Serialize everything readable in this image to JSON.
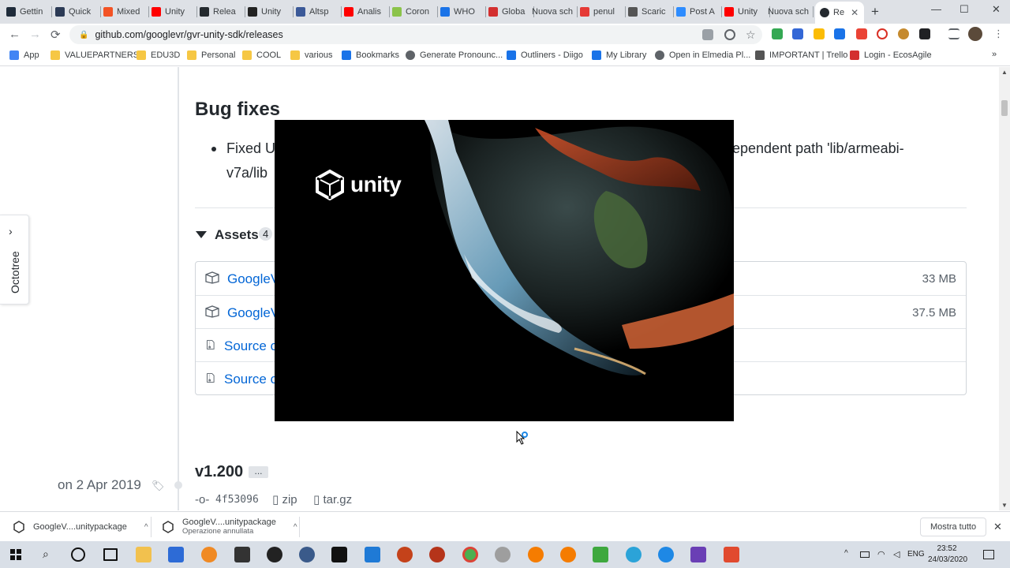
{
  "browser": {
    "tabs": [
      {
        "label": "Gettin",
        "color": "#1f2b3a"
      },
      {
        "label": "Quick",
        "color": "#2b3a55"
      },
      {
        "label": "Mixed",
        "color": "#f35325"
      },
      {
        "label": "Unity",
        "color": "#ff0000"
      },
      {
        "label": "Relea",
        "color": "#24292e"
      },
      {
        "label": "Unity",
        "color": "#222222"
      },
      {
        "label": "Altsp",
        "color": "#3b5998"
      },
      {
        "label": "Analis",
        "color": "#ff0000"
      },
      {
        "label": "Coron",
        "color": "#8bc34a"
      },
      {
        "label": "WHO",
        "color": "#1a73e8"
      },
      {
        "label": "Globa",
        "color": "#d32f2f"
      },
      {
        "label": "Nuova sch",
        "color": ""
      },
      {
        "label": "penul",
        "color": "#e53935"
      },
      {
        "label": "Scaric",
        "color": "#555555"
      },
      {
        "label": "Post A",
        "color": "#2d8cff"
      },
      {
        "label": "Unity",
        "color": "#ff0000"
      },
      {
        "label": "Nuova sch",
        "color": ""
      }
    ],
    "active_tab": {
      "label": "Re",
      "close": "✕"
    },
    "new_tab": "+",
    "window": {
      "minimize": "—",
      "maximize": "☐",
      "close": "✕"
    },
    "url": "github.com/googlevr/gvr-unity-sdk/releases",
    "nav": {
      "back": "←",
      "forward": "→",
      "reload": "⟳"
    },
    "bookmarks": [
      {
        "label": "App",
        "kind": "apps"
      },
      {
        "label": "VALUEPARTNERS",
        "kind": "folder"
      },
      {
        "label": "EDU3D",
        "kind": "folder"
      },
      {
        "label": "Personal",
        "kind": "folder"
      },
      {
        "label": "COOL",
        "kind": "folder"
      },
      {
        "label": "various",
        "kind": "folder"
      },
      {
        "label": "Bookmarks",
        "kind": "star"
      },
      {
        "label": "Generate Pronounc...",
        "kind": "globe"
      },
      {
        "label": "Outliners - Diigo",
        "kind": "diigo"
      },
      {
        "label": "My Library",
        "kind": "diigo"
      },
      {
        "label": "Open in Elmedia Pl...",
        "kind": "globe"
      },
      {
        "label": "IMPORTANT | Trello",
        "kind": "trello"
      },
      {
        "label": "Login - EcosAgile",
        "kind": "ecos"
      }
    ],
    "bookmarks_more": "»"
  },
  "page": {
    "section_heading": "Bug fixes",
    "bug_item": {
      "part1": "Fixed U",
      "part2": "ependent path 'lib/armeabi-",
      "part3": "v7a/lib"
    },
    "assets": {
      "label": "Assets",
      "count": "4",
      "rows": [
        {
          "name": "GoogleV",
          "size": "33 MB",
          "icon": "package-icon"
        },
        {
          "name": "GoogleV",
          "size": "37.5 MB",
          "icon": "package-icon"
        },
        {
          "name": "Source c",
          "size": "",
          "icon": "zip-icon"
        },
        {
          "name": "Source c",
          "size": "",
          "icon": "zip-icon"
        }
      ]
    },
    "octotree": {
      "label": "Octotree",
      "chevron": "›"
    },
    "release": {
      "date": "on 2 Apr 2019",
      "version": "v1.200",
      "more": "...",
      "commit": "4f53096",
      "zip": "zip",
      "targz": "tar.gz"
    }
  },
  "splash": {
    "logo_text": "unity"
  },
  "downloads": {
    "items": [
      {
        "name": "GoogleV....unitypackage",
        "status": ""
      },
      {
        "name": "GoogleV....unitypackage",
        "status": "Operazione annullata"
      }
    ],
    "show_all": "Mostra tutto",
    "close": "✕"
  },
  "taskbar": {
    "language": "ENG",
    "time": "23:52",
    "date": "24/03/2020"
  }
}
